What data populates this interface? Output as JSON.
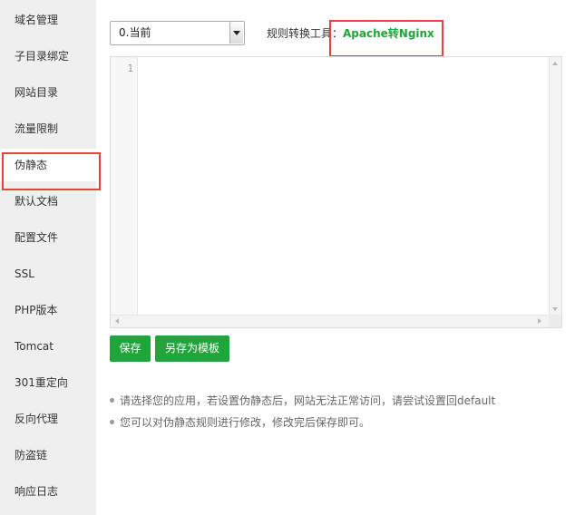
{
  "sidebar": {
    "items": [
      {
        "label": "域名管理"
      },
      {
        "label": "子目录绑定"
      },
      {
        "label": "网站目录"
      },
      {
        "label": "流量限制"
      },
      {
        "label": "伪静态"
      },
      {
        "label": "默认文档"
      },
      {
        "label": "配置文件"
      },
      {
        "label": "SSL"
      },
      {
        "label": "PHP版本"
      },
      {
        "label": "Tomcat"
      },
      {
        "label": "301重定向"
      },
      {
        "label": "反向代理"
      },
      {
        "label": "防盗链"
      },
      {
        "label": "响应日志"
      }
    ],
    "active": "伪静态"
  },
  "rewrite": {
    "select_value": "0.当前",
    "tool_label": "规则转换工具：",
    "tool_link": "Apache转Nginx"
  },
  "editor": {
    "line_number": "1",
    "content": ""
  },
  "buttons": {
    "save": "保存",
    "save_as_template": "另存为模板"
  },
  "tips": [
    "请选择您的应用，若设置伪静态后，网站无法正常访问，请尝试设置回default",
    "您可以对伪静态规则进行修改，修改完后保存即可。"
  ],
  "colors": {
    "accent": "#20a53a",
    "highlight": "#e83f3f",
    "sidebar_bg": "#efefef"
  }
}
